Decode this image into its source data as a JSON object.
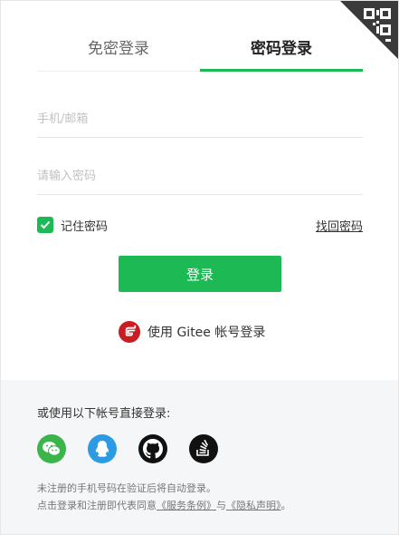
{
  "tabs": [
    {
      "label": "免密登录",
      "active": false
    },
    {
      "label": "密码登录",
      "active": true
    }
  ],
  "form": {
    "phone_placeholder": "手机/邮箱",
    "phone_value": "",
    "password_placeholder": "请输入密码",
    "password_value": "",
    "remember_label": "记住密码",
    "remember_checked": true,
    "forgot_label": "找回密码",
    "login_label": "登录"
  },
  "gitee": {
    "label": "使用 Gitee 帐号登录",
    "icon": "gitee-icon"
  },
  "other": {
    "title": "或使用以下帐号直接登录:",
    "providers": [
      "wechat-icon",
      "qq-icon",
      "github-icon",
      "stackoverflow-icon"
    ]
  },
  "notice": {
    "line1": "未注册的手机号码在验证后将自动登录。",
    "line2_prefix": "点击登录和注册即代表同意",
    "terms": "《服务条例》",
    "and": "与",
    "privacy": "《隐私声明》",
    "end": "。"
  },
  "colors": {
    "accent": "#1db954",
    "gitee": "#c71d23",
    "bottom_bg": "#f5f6f7"
  }
}
